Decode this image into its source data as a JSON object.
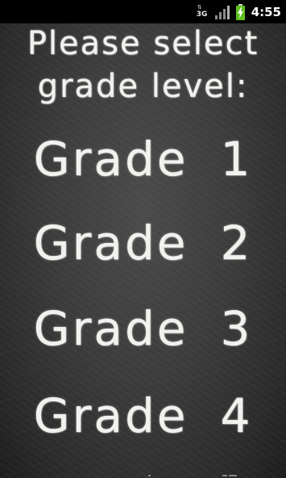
{
  "status_bar": {
    "network_type": "3G",
    "time": "4:55",
    "icons": [
      "data-activity-icon",
      "signal-strength-icon",
      "battery-charging-icon"
    ]
  },
  "prompt": {
    "line1": "Please select",
    "line2": "grade level:"
  },
  "grades": [
    {
      "word": "Grade",
      "number": "1"
    },
    {
      "word": "Grade",
      "number": "2"
    },
    {
      "word": "Grade",
      "number": "3"
    },
    {
      "word": "Grade",
      "number": "4"
    }
  ],
  "colors": {
    "chalkboard": "#3b3c3b",
    "chalk": "#f1f1ee",
    "battery": "#5fbf1f"
  }
}
